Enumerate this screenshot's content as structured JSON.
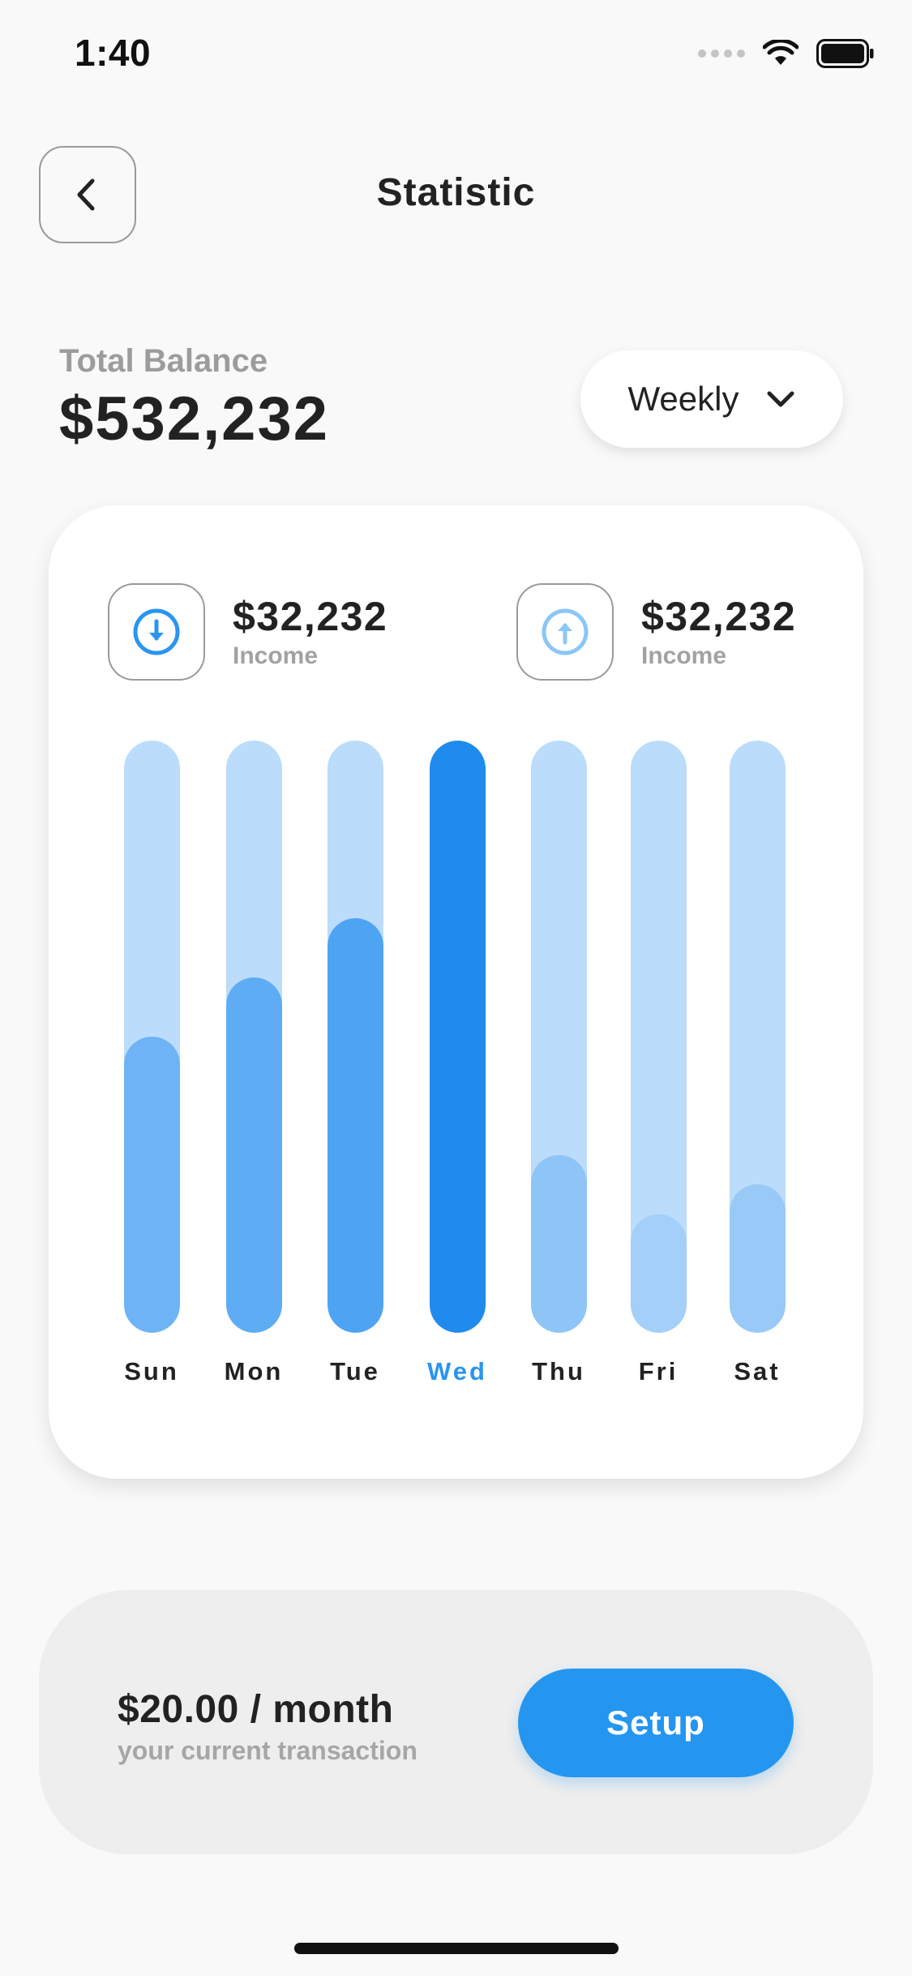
{
  "status_bar": {
    "time": "1:40"
  },
  "header": {
    "title": "Statistic",
    "back_icon": "chevron-left-icon"
  },
  "balance": {
    "label": "Total Balance",
    "value": "$532,232"
  },
  "period_select": {
    "selected": "Weekly",
    "icon": "chevron-down-icon"
  },
  "summary": [
    {
      "amount": "$32,232",
      "label": "Income",
      "icon": "arrow-down-circle-icon",
      "color": "#2a95ef"
    },
    {
      "amount": "$32,232",
      "label": "Income",
      "icon": "arrow-up-circle-icon",
      "color": "#8cc6f6"
    }
  ],
  "chart_data": {
    "type": "bar",
    "categories": [
      "Sun",
      "Mon",
      "Tue",
      "Wed",
      "Thu",
      "Fri",
      "Sat"
    ],
    "values": [
      0.5,
      0.6,
      0.7,
      1.0,
      0.3,
      0.2,
      0.25
    ],
    "ylim": [
      0,
      1
    ],
    "highlighted": "Wed",
    "grid": false,
    "colors": {
      "track": "#bbdcfa",
      "fill": [
        "#6db3f5",
        "#5eacf4",
        "#4ea4f3",
        "#1f8bed",
        "#8fc4f6",
        "#a3cff8",
        "#98c9f7"
      ],
      "active_label": "#2a95ef"
    }
  },
  "plan": {
    "price": "$20.00 / month",
    "subtitle": "your current transaction",
    "button_label": "Setup",
    "button_color": "#2496f0"
  }
}
